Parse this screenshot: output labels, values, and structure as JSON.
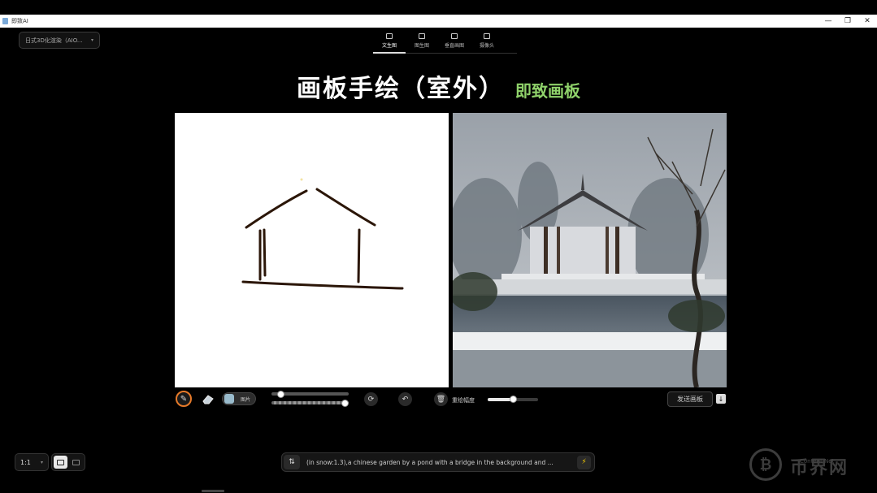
{
  "window": {
    "title": "即致AI",
    "controls": [
      "—",
      "❐",
      "✕"
    ]
  },
  "model_selector": {
    "value": "日式3D化渲染（AIO...",
    "icon": "chevron-down-icon"
  },
  "tabs": [
    {
      "label": "文生图",
      "icon": "text-to-image-icon",
      "active": true
    },
    {
      "label": "图生图",
      "icon": "image-to-image-icon",
      "active": false
    },
    {
      "label": "垂直画图",
      "icon": "vertical-draw-icon",
      "active": false
    },
    {
      "label": "摄像头",
      "icon": "camera-icon",
      "active": false
    }
  ],
  "heading": {
    "main": "画板手绘（室外）",
    "accent": "即致画板",
    "accent_color": "#8fd16a"
  },
  "toolbar": {
    "image_label": "图片",
    "brush_size": 0.12,
    "brush_opacity": 0.95,
    "strength_label": "重绘幅度",
    "strength_value": 0.5,
    "send_label": "发送画板",
    "brush_ring_color": "#e67a2a"
  },
  "bottom": {
    "ratio_value": "1:1",
    "prompt": "(in snow:1.3),a chinese garden by a pond with a bridge in the background and ...",
    "generate_icon": "lightning-icon",
    "generate_color": "#ffd400"
  },
  "watermark": {
    "text": "币界网",
    "sub": "Content Net"
  }
}
